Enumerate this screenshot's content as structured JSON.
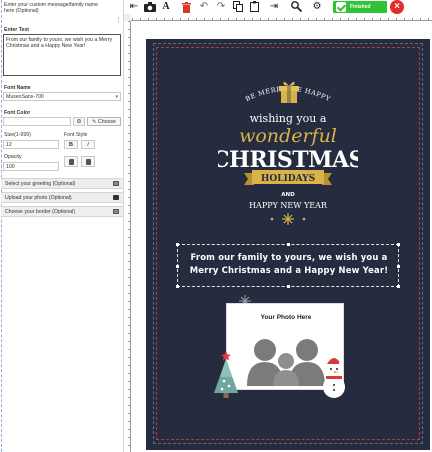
{
  "panel": {
    "prompt": "Enter your custom message/family name here (Optional)",
    "enter_text_label": "Enter Text",
    "text_value": "From our family to yours, we wish you a Merry Christmas and a Happy New Year!",
    "font_name_label": "Font Name",
    "font_name_value": "MuseoSans-700",
    "font_color_label": "Font Color",
    "choose_label": "Choose",
    "size_label": "Size(1-999)",
    "size_value": "12",
    "font_style_label": "Font Style",
    "bold_label": "B",
    "italic_label": "I",
    "opacity_label": "Opacity",
    "opacity_value": "100",
    "sections": [
      {
        "label": "Select your greeting (Optional)",
        "icon": "image-icon"
      },
      {
        "label": "Upload your photo (Optional)",
        "icon": "camera-icon"
      },
      {
        "label": "Choose your border (Optional)",
        "icon": "image-icon"
      }
    ]
  },
  "toolbar": {
    "tools": [
      "exit-icon",
      "camera-icon",
      "text-icon",
      "trash-icon",
      "undo-icon",
      "redo-icon",
      "copy-icon",
      "paste-icon",
      "layer-icon",
      "zoom-icon",
      "settings-icon"
    ],
    "finish_label": "Finished Editing",
    "close_label": "×",
    "accent": "#2ec436",
    "close_color": "#e52b2b"
  },
  "card": {
    "background": "#262c40",
    "greeting": {
      "line1": "BE MERRY, BE HAPPY",
      "line2": "wishing you a",
      "line3": "wonderful",
      "line4": "CHRISTMAS",
      "line5": "HOLIDAYS",
      "line6": "AND",
      "line7": "HAPPY NEW YEAR"
    },
    "message": "From our family to yours, we wish you a Merry Christmas and a Happy New Year!",
    "photo_placeholder": "Your Photo Here",
    "gold": "#d9b24a"
  }
}
